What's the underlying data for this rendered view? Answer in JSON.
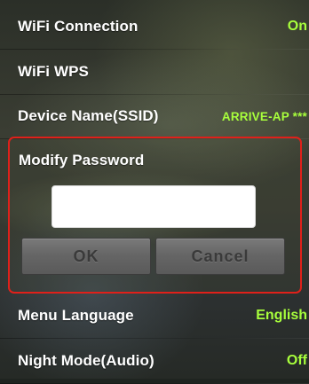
{
  "settings": {
    "wifi_connection": {
      "label": "WiFi Connection",
      "value": "On"
    },
    "wifi_wps": {
      "label": "WiFi WPS"
    },
    "device_name": {
      "label": "Device Name(SSID)",
      "value": "ARRIVE-AP ***"
    },
    "modify_password": {
      "label": "Modify Password",
      "input_value": "",
      "ok_label": "OK",
      "cancel_label": "Cancel"
    },
    "menu_language": {
      "label": "Menu Language",
      "value": "English"
    },
    "night_mode": {
      "label": "Night Mode(Audio)",
      "value": "Off"
    }
  },
  "colors": {
    "value_accent": "#a8ff3c",
    "highlight_border": "#e0201a",
    "label_text": "#ffffff"
  }
}
